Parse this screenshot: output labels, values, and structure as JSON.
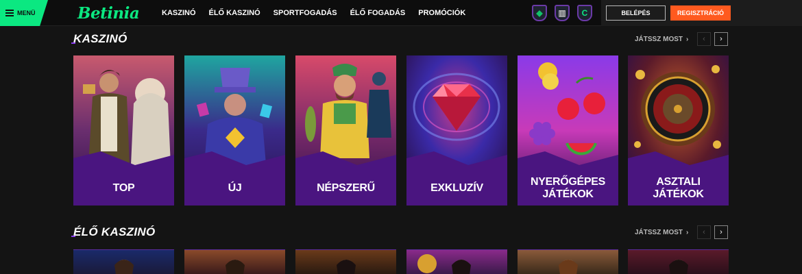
{
  "header": {
    "menu_label": "MENÜ",
    "logo": "Betinia",
    "nav": [
      "KASZINÓ",
      "ÉLŐ KASZINÓ",
      "SPORTFOGADÁS",
      "ÉLŐ FOGADÁS",
      "PROMÓCIÓK"
    ],
    "login_label": "Belépés",
    "register_label": "Regisztráció",
    "accent_color": "#0be881",
    "register_color": "#ff5a1f"
  },
  "sections": [
    {
      "title": "KASZINÓ",
      "play_more": "JÁTSSZ MOST",
      "cards": [
        {
          "label": "TOP"
        },
        {
          "label": "ÚJ"
        },
        {
          "label": "NÉPSZERŰ"
        },
        {
          "label": "EXKLUZÍV"
        },
        {
          "label": "NYERŐGÉPES JÁTÉKOK"
        },
        {
          "label": "ASZTALI JÁTÉKOK"
        }
      ]
    },
    {
      "title": "ÉLŐ KASZINÓ",
      "play_more": "JÁTSSZ MOST"
    }
  ]
}
